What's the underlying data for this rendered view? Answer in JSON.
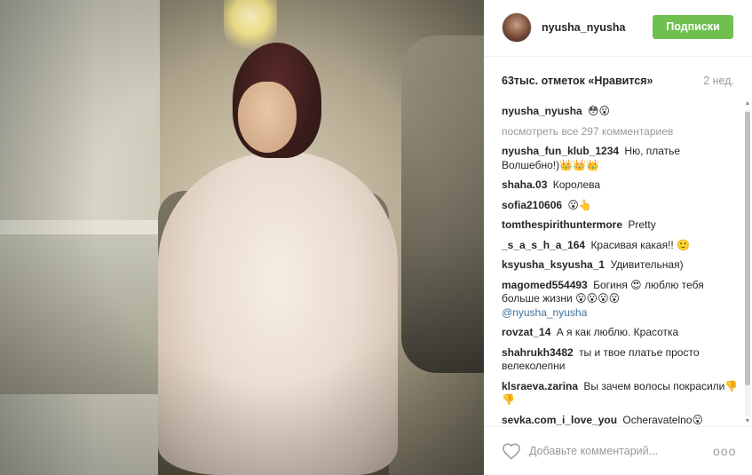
{
  "post": {
    "author": "nyusha_nyusha",
    "follow_label": "Подписки",
    "likes_text": "63тыс. отметок «Нравится»",
    "time_text": "2 нед.",
    "colors": {
      "follow": "#70c050",
      "mention": "#3f729b",
      "muted": "#999999"
    }
  },
  "caption": {
    "user": "nyusha_nyusha",
    "text": "😳😮"
  },
  "view_all": "посмотреть все 297 комментариев",
  "comments": [
    {
      "user": "nyusha_fun_klub_1234",
      "text": "Ню, платье Волшебно!)👑👑👑"
    },
    {
      "user": "shaha.03",
      "text": "Королева"
    },
    {
      "user": "sofia210606",
      "text": "😮👆"
    },
    {
      "user": "tomthespirithuntermore",
      "text": "Pretty"
    },
    {
      "user": "_s_a_s_h_a_164",
      "text": "Красивая какая!! 🙂"
    },
    {
      "user": "ksyusha_ksyusha_1",
      "text": "Удивительная)"
    },
    {
      "user": "magomed554493",
      "text": "Богиня 😍 люблю тебя больше жизни 😮😮😮😮",
      "mention": "@nyusha_nyusha"
    },
    {
      "user": "rovzat_14",
      "text": "А я как люблю. Красотка"
    },
    {
      "user": "shahrukh3482",
      "text": "ты и твое платье просто велеколепни"
    },
    {
      "user": "klsraeva.zarina",
      "text": "Вы зачем волосы покрасили👎👎"
    },
    {
      "user": "sevka.com_i_love_you",
      "text": "Ocheravatelno😮"
    }
  ],
  "footer": {
    "placeholder": "Добавьте комментарий...",
    "more_label": "ooo",
    "heart_icon": "heart-outline-icon"
  }
}
